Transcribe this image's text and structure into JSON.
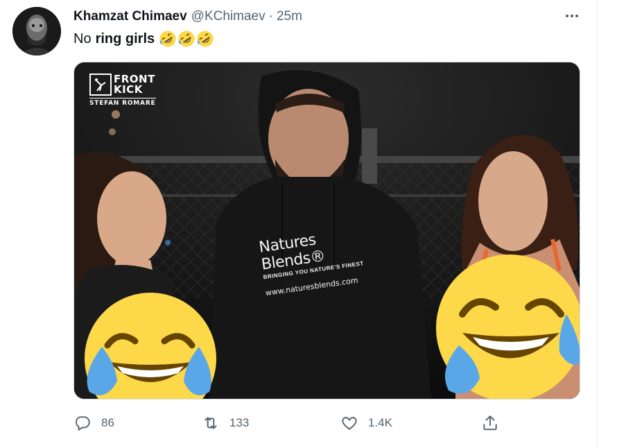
{
  "tweet": {
    "display_name": "Khamzat Chimaev",
    "handle": "@KChimaev",
    "separator": "·",
    "timestamp": "25m",
    "text_plain": "No",
    "text_bold": "ring girls",
    "text_emoji": [
      "rolling-on-floor-laughing",
      "rolling-on-floor-laughing",
      "rolling-on-floor-laughing"
    ]
  },
  "media": {
    "watermark": {
      "line1": "FRONT",
      "line2": "KICK",
      "photographer": "STEFAN ROMARE"
    },
    "hoodie": {
      "brand": "Natures Blends®",
      "tagline": "BRINGING YOU NATURE'S FINEST",
      "url": "www.naturesblends.com"
    },
    "overlay_emoji": "face-with-tears-of-joy"
  },
  "actions": {
    "reply": {
      "icon": "reply-icon",
      "count": "86"
    },
    "retweet": {
      "icon": "retweet-icon",
      "count": "133"
    },
    "like": {
      "icon": "heart-icon",
      "count": "1.4K"
    },
    "share": {
      "icon": "share-icon"
    }
  },
  "colors": {
    "text_primary": "#0f1419",
    "text_secondary": "#536471",
    "emoji_yellow": "#fdd94a",
    "emoji_tear": "#5aa7e8"
  }
}
